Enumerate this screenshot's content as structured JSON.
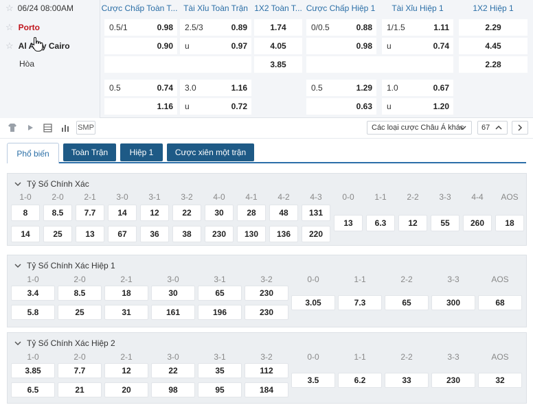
{
  "match": {
    "datetime": "06/24 08:00AM",
    "home": "Porto",
    "away": "Al Ahly Cairo",
    "draw": "Hòa"
  },
  "headers": [
    "Cược Chấp Toàn T...",
    "Tài Xỉu Toàn Trận",
    "1X2 Toàn T...",
    "Cược Chấp Hiệp 1",
    "Tài Xỉu Hiệp 1",
    "1X2 Hiệp 1"
  ],
  "odds": {
    "r1": {
      "hcp_line": "0.5/1",
      "hcp_home": "0.98",
      "ou_line": "2.5/3",
      "ou_over": "0.89",
      "x12_home": "1.74",
      "h1_hcp_line": "0/0.5",
      "h1_hcp_home": "0.88",
      "h1_ou_line": "1/1.5",
      "h1_ou_over": "1.11",
      "h1_x12_home": "2.29"
    },
    "r2": {
      "hcp_away": "0.90",
      "ou_u": "u",
      "ou_under": "0.97",
      "x12_away": "4.05",
      "h1_hcp_away": "0.98",
      "h1_ou_u": "u",
      "h1_ou_under": "0.74",
      "h1_x12_away": "4.45"
    },
    "r3": {
      "x12_draw": "3.85",
      "h1_x12_draw": "2.28"
    },
    "r4": {
      "hcp_line": "0.5",
      "hcp_home": "0.74",
      "ou_line": "3.0",
      "ou_over": "1.16",
      "h1_hcp_line": "0.5",
      "h1_hcp_home": "1.29",
      "h1_ou_line": "1.0",
      "h1_ou_over": "0.67"
    },
    "r5": {
      "hcp_away": "1.16",
      "ou_u": "u",
      "ou_under": "0.72",
      "h1_hcp_away": "0.63",
      "h1_ou_u": "u",
      "h1_ou_under": "1.20"
    }
  },
  "toolbar": {
    "smp": "SMP",
    "market_select": "Các loại cược Châu Á khác",
    "count": "67"
  },
  "tabs": [
    "Phổ biến",
    "Toàn Trận",
    "Hiệp 1",
    "Cược xiên một trận"
  ],
  "sections": {
    "cs_full": {
      "title": "Tỷ Số Chính Xác",
      "labels": [
        "1-0",
        "2-0",
        "2-1",
        "3-0",
        "3-1",
        "3-2",
        "4-0",
        "4-1",
        "4-2",
        "4-3",
        "0-0",
        "1-1",
        "2-2",
        "3-3",
        "4-4",
        "AOS"
      ],
      "home": [
        "8",
        "8.5",
        "7.7",
        "14",
        "12",
        "22",
        "30",
        "28",
        "48",
        "131"
      ],
      "away": [
        "14",
        "25",
        "13",
        "67",
        "36",
        "38",
        "230",
        "130",
        "136",
        "220"
      ],
      "draws": [
        "13",
        "6.3",
        "12",
        "55",
        "260",
        "18"
      ]
    },
    "cs_h1": {
      "title": "Tỷ Số Chính Xác Hiệp 1",
      "labels": [
        "1-0",
        "2-0",
        "2-1",
        "3-0",
        "3-1",
        "3-2",
        "0-0",
        "1-1",
        "2-2",
        "3-3",
        "AOS"
      ],
      "home": [
        "3.4",
        "8.5",
        "18",
        "30",
        "65",
        "230"
      ],
      "away": [
        "5.8",
        "25",
        "31",
        "161",
        "196",
        "230"
      ],
      "draws": [
        "3.05",
        "7.3",
        "65",
        "300",
        "68"
      ]
    },
    "cs_h2": {
      "title": "Tỷ Số Chính Xác Hiệp 2",
      "labels": [
        "1-0",
        "2-0",
        "2-1",
        "3-0",
        "3-1",
        "3-2",
        "0-0",
        "1-1",
        "2-2",
        "3-3",
        "AOS"
      ],
      "home": [
        "3.85",
        "7.7",
        "12",
        "22",
        "35",
        "112"
      ],
      "away": [
        "6.5",
        "21",
        "20",
        "98",
        "95",
        "184"
      ],
      "draws": [
        "3.5",
        "6.2",
        "33",
        "230",
        "32"
      ]
    }
  }
}
